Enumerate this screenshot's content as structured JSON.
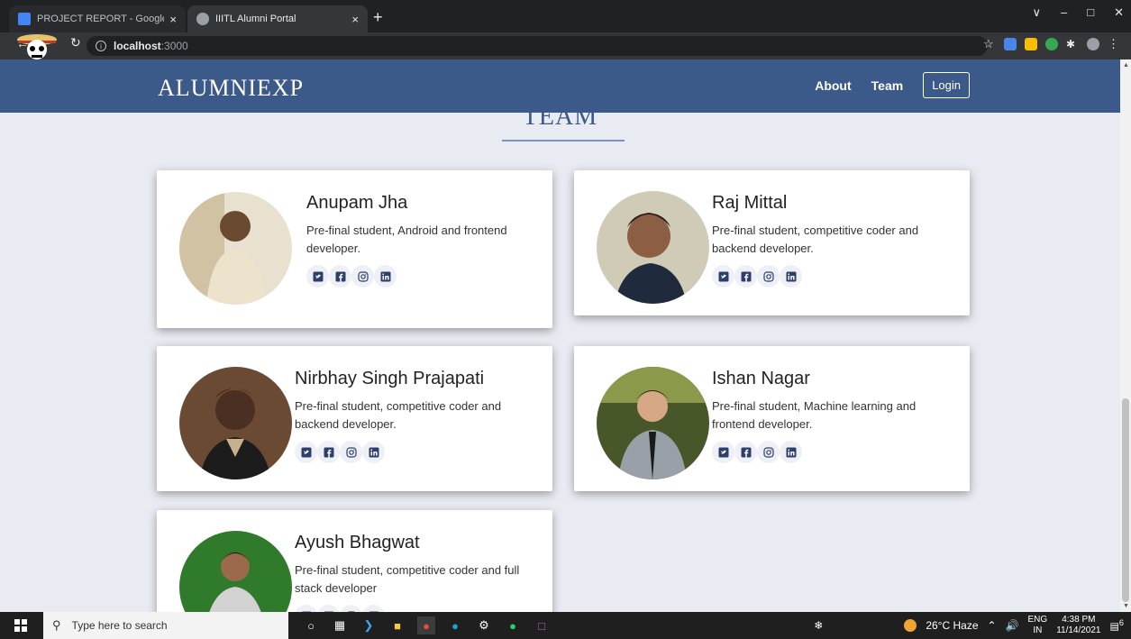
{
  "browser": {
    "tabs": [
      {
        "title": "PROJECT REPORT - Google Docs",
        "close": "×"
      },
      {
        "title": "IIITL Alumni Portal",
        "close": "×"
      }
    ],
    "new_tab": "+",
    "url_host": "localhost",
    "url_port": ":3000",
    "controls": [
      "∨",
      "–",
      "□",
      "✕"
    ]
  },
  "navbar": {
    "brand": "ALUMNIEXP",
    "links": [
      "About",
      "Team"
    ],
    "login": "Login"
  },
  "section": {
    "title": "TEAM"
  },
  "members": [
    {
      "name": "Anupam Jha",
      "desc": "Pre-final student, Android and frontend developer.",
      "photo_bg": "#d9c7a9",
      "shirt": "#e8dcc4"
    },
    {
      "name": "Raj Mittal",
      "desc": "Pre-final student, competitive coder and backend developer.",
      "photo_bg": "#b9b39a",
      "shirt": "#273248"
    },
    {
      "name": "Nirbhay Singh Prajapati",
      "desc": "Pre-final student, competitive coder and backend developer.",
      "photo_bg": "#5b3b2a",
      "shirt": "#1e1e1e"
    },
    {
      "name": "Ishan Nagar",
      "desc": "Pre-final student, Machine learning and frontend developer.",
      "photo_bg": "#3d4a1f",
      "shirt": "#888d94"
    },
    {
      "name": "Ayush Bhagwat",
      "desc": "Pre-final student, competitive coder and full stack developer",
      "photo_bg": "#2f7a2b",
      "shirt": "#c9c9c9"
    }
  ],
  "social_icons": [
    "twitter-icon",
    "facebook-icon",
    "instagram-icon",
    "linkedin-icon"
  ],
  "colors": {
    "navbar": "#3b5a8a",
    "accent": "#7b91c9",
    "background": "#e8ebf1",
    "icon": "#2c3e6b"
  },
  "taskbar": {
    "search_placeholder": "Type here to search",
    "weather": "26°C  Haze",
    "lang_top": "ENG",
    "lang_bottom": "IN",
    "time": "4:38 PM",
    "date": "11/14/2021",
    "notifications": "6"
  }
}
